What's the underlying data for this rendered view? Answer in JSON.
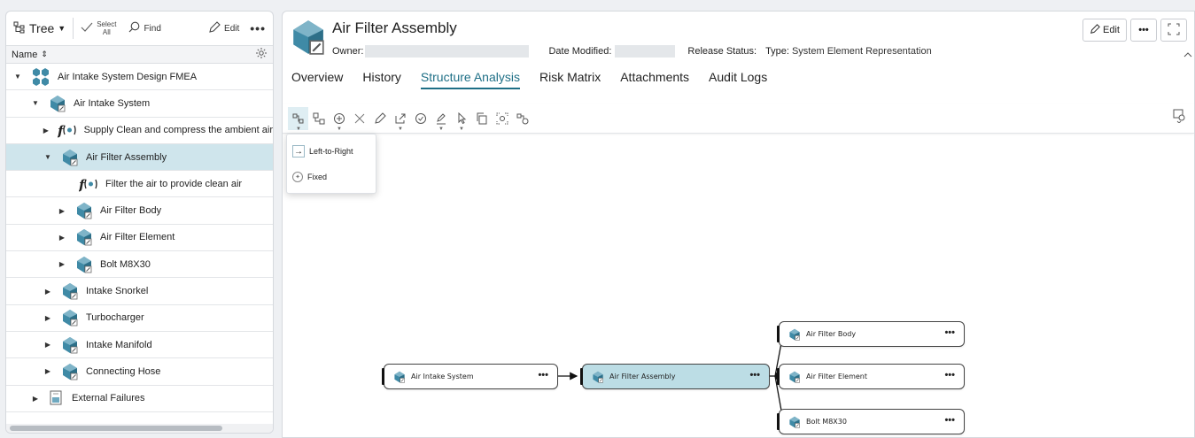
{
  "tree_panel": {
    "view_label": "Tree",
    "select_all_line1": "Select",
    "select_all_line2": "All",
    "find_label": "Find",
    "edit_label": "Edit",
    "more_label": "•••",
    "column_header": "Name",
    "sort_icon": "⇕",
    "items": [
      {
        "label": "Air Intake System Design FMEA",
        "caret": "▼",
        "icon": "fmea-icon"
      },
      {
        "label": "Air Intake System",
        "caret": "▼",
        "icon": "system-element-icon"
      },
      {
        "label": "Supply Clean and compress the ambient air",
        "caret": "▶",
        "icon": "function-icon"
      },
      {
        "label": "Air Filter Assembly",
        "caret": "▼",
        "icon": "system-element-icon"
      },
      {
        "label": "Filter the air to provide clean air",
        "caret": "",
        "icon": "function-icon"
      },
      {
        "label": "Air Filter Body",
        "caret": "▶",
        "icon": "system-element-icon"
      },
      {
        "label": "Air Filter Element",
        "caret": "▶",
        "icon": "system-element-icon"
      },
      {
        "label": "Bolt M8X30",
        "caret": "▶",
        "icon": "system-element-icon"
      },
      {
        "label": "Intake Snorkel",
        "caret": "▶",
        "icon": "system-element-icon"
      },
      {
        "label": "Turbocharger",
        "caret": "▶",
        "icon": "system-element-icon"
      },
      {
        "label": "Intake Manifold",
        "caret": "▶",
        "icon": "system-element-icon"
      },
      {
        "label": "Connecting Hose",
        "caret": "▶",
        "icon": "system-element-icon"
      },
      {
        "label": "External Failures",
        "caret": "▶",
        "icon": "document-icon"
      }
    ]
  },
  "detail": {
    "title": "Air Filter Assembly",
    "owner_label": "Owner:",
    "owner_value": "",
    "date_label": "Date Modified:",
    "date_value": "",
    "release_label": "Release Status:",
    "type_label": "Type:",
    "type_value": "System Element Representation",
    "edit_label": "Edit",
    "more_label": "•••",
    "tabs": [
      "Overview",
      "History",
      "Structure Analysis",
      "Risk Matrix",
      "Attachments",
      "Audit Logs"
    ],
    "active_tab": "Structure Analysis"
  },
  "layout_menu": {
    "items": [
      {
        "label": "Left-to-Right",
        "icon": "arrow-right-icon"
      },
      {
        "label": "Fixed",
        "icon": "fixed-icon"
      }
    ]
  },
  "diagram": {
    "nodes": [
      {
        "id": "n1",
        "label": "Air Intake System",
        "more": "•••"
      },
      {
        "id": "n2",
        "label": "Air Filter Assembly",
        "more": "•••"
      },
      {
        "id": "n3",
        "label": "Air Filter Body",
        "more": "•••"
      },
      {
        "id": "n4",
        "label": "Air Filter Element",
        "more": "•••"
      },
      {
        "id": "n5",
        "label": "Bolt M8X30",
        "more": "•••"
      }
    ]
  },
  "colors": {
    "accent": "#1e6f86",
    "selection": "#cfe5ec",
    "icon_teal": "#3f8aa6"
  }
}
